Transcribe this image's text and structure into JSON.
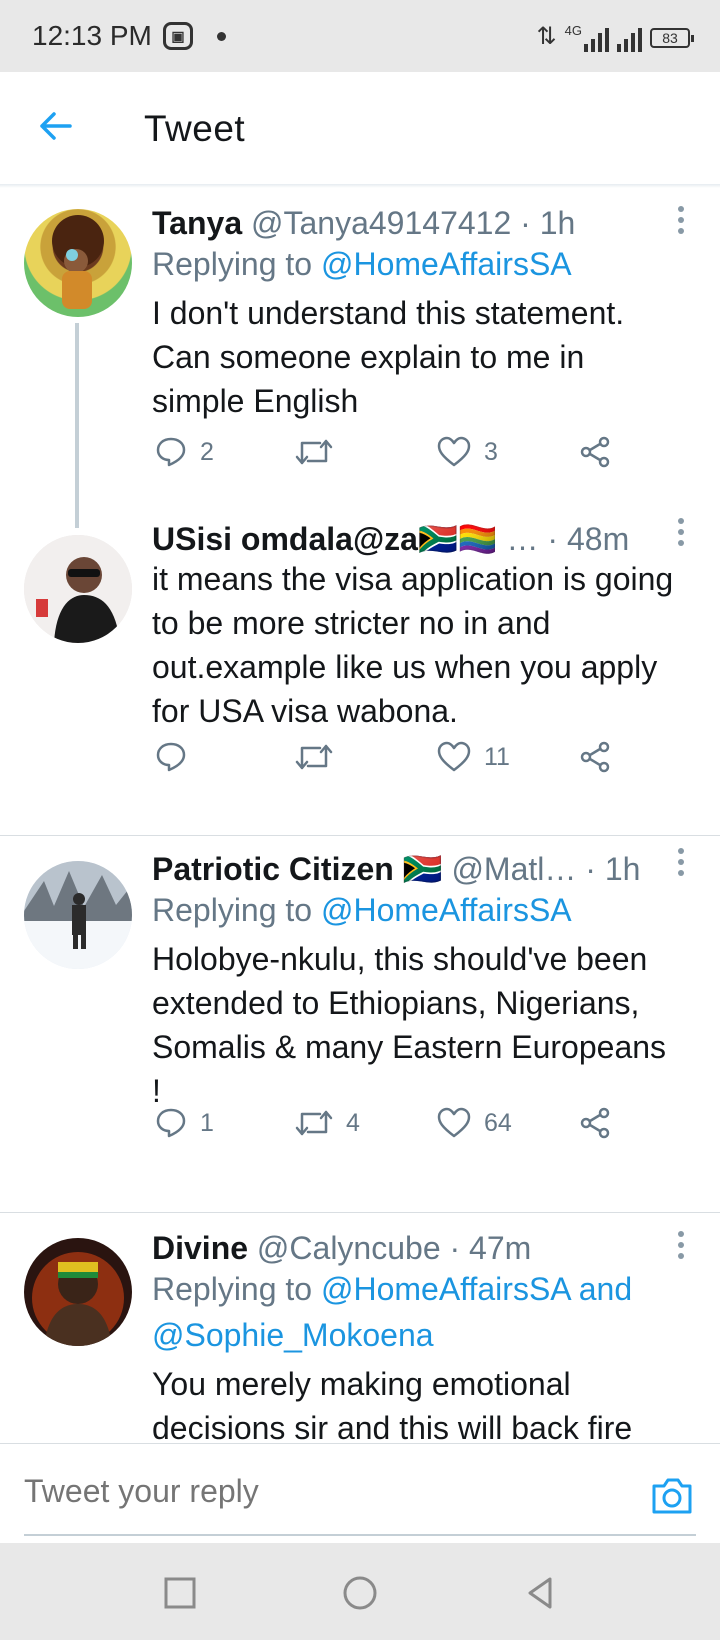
{
  "status_bar": {
    "time": "12:13 PM",
    "network": "4G",
    "battery": "83"
  },
  "header": {
    "title": "Tweet"
  },
  "tweets": [
    {
      "name": "Tanya",
      "handle": "@Tanya49147412",
      "time": "· 1h",
      "replying_prefix": "Replying to",
      "replying_to": "@HomeAffairsSA",
      "text": "I don't understand this statement. Can someone explain to me in simple English",
      "replies": "2",
      "retweets": "",
      "likes": "3"
    },
    {
      "name": "USisi omdala@za🇿🇦🏳️‍🌈",
      "handle": "…",
      "time": "· 48m",
      "text": "it means the visa application is going to be more stricter no in and out.example like us when you apply for USA visa wabona.",
      "replies": "",
      "retweets": "",
      "likes": "11"
    },
    {
      "name": "Patriotic Citizen 🇿🇦",
      "handle": "@Matl…",
      "time": "· 1h",
      "replying_prefix": "Replying to",
      "replying_to": "@HomeAffairsSA",
      "text": "Holobye-nkulu, this should've been extended to Ethiopians, Nigerians, Somalis & many Eastern Europeans !",
      "replies": "1",
      "retweets": "4",
      "likes": "64"
    },
    {
      "name": "Divine",
      "handle": "@Calyncube",
      "time": "· 47m",
      "replying_prefix": "Replying to",
      "replying_to": "@HomeAffairsSA and @Sophie_Mokoena",
      "text": "You merely making emotional decisions sir and this will back fire"
    }
  ],
  "reply_bar": {
    "placeholder": "Tweet your reply"
  },
  "icons": {
    "back": "arrow-left-icon",
    "more": "more-vertical-icon",
    "reply": "reply-icon",
    "retweet": "retweet-icon",
    "like": "heart-icon",
    "share": "share-icon",
    "camera": "camera-icon",
    "nav_recents": "square-icon",
    "nav_home": "circle-icon",
    "nav_back": "triangle-back-icon"
  },
  "colors": {
    "accent": "#1da1f2",
    "link": "#1b95e0",
    "secondary_text": "#657786",
    "primary_text": "#14171a"
  }
}
